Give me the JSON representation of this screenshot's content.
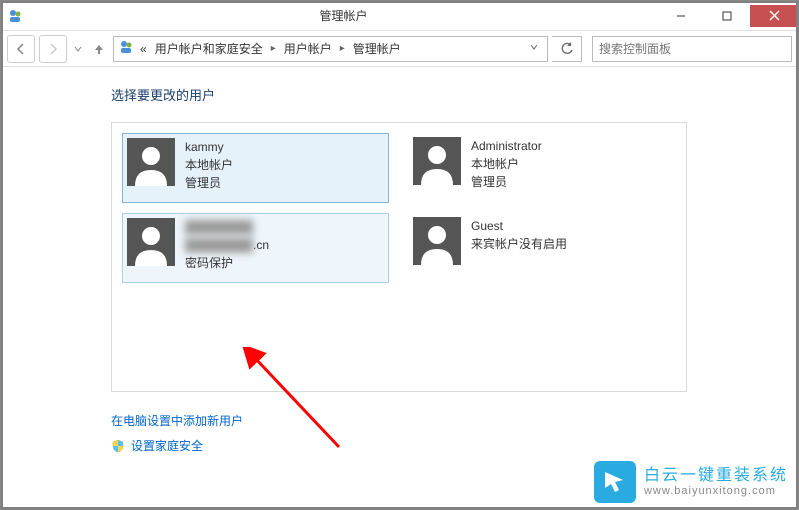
{
  "window": {
    "title": "管理帐户"
  },
  "nav": {
    "breadcrumb_prefix": "«",
    "crumbs": [
      "用户帐户和家庭安全",
      "用户帐户",
      "管理帐户"
    ],
    "search_placeholder": "搜索控制面板"
  },
  "page": {
    "heading": "选择要更改的用户"
  },
  "users": [
    {
      "name": "kammy",
      "line1": "本地帐户",
      "line2": "管理员",
      "state": "selected"
    },
    {
      "name": "Administrator",
      "line1": "本地帐户",
      "line2": "管理员",
      "state": "normal"
    },
    {
      "name": "",
      "name_suffix": ".cn",
      "line1": "密码保护",
      "line2": "",
      "state": "hover",
      "blurred": true
    },
    {
      "name": "Guest",
      "line1": "来宾帐户没有启用",
      "line2": "",
      "state": "normal"
    }
  ],
  "links": {
    "add_user": "在电脑设置中添加新用户",
    "family_safety": "设置家庭安全"
  },
  "watermark": {
    "line1": "白云一键重装系统",
    "line2": "www.baiyunxitong.com"
  }
}
